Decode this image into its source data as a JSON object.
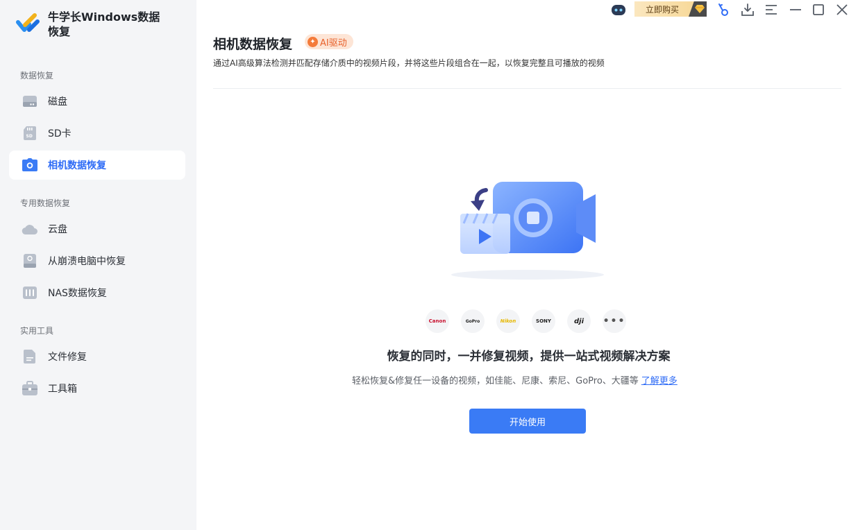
{
  "app": {
    "title": "牛学长Windows数据恢复"
  },
  "sidebar": {
    "sections": [
      {
        "label": "数据恢复"
      },
      {
        "label": "专用数据恢复"
      },
      {
        "label": "实用工具"
      }
    ],
    "items": [
      {
        "label": "磁盘",
        "icon": "disk-icon",
        "active": false
      },
      {
        "label": "SD卡",
        "icon": "sd-card-icon",
        "active": false
      },
      {
        "label": "相机数据恢复",
        "icon": "camera-icon",
        "active": true
      },
      {
        "label": "云盘",
        "icon": "cloud-icon",
        "active": false
      },
      {
        "label": "从崩溃电脑中恢复",
        "icon": "crashed-pc-icon",
        "active": false
      },
      {
        "label": "NAS数据恢复",
        "icon": "nas-icon",
        "active": false
      },
      {
        "label": "文件修复",
        "icon": "file-repair-icon",
        "active": false
      },
      {
        "label": "工具箱",
        "icon": "toolbox-icon",
        "active": false
      }
    ]
  },
  "topbar": {
    "buy_label": "立即购买"
  },
  "main": {
    "title": "相机数据恢复",
    "ai_badge": "AI驱动",
    "description": "通过AI高级算法检测并匹配存储介质中的视频片段，并将这些片段组合在一起，以恢复完整且可播放的视频",
    "brands": [
      "Canon",
      "GoPro",
      "Nikon",
      "SONY",
      "dji",
      "more"
    ],
    "headline": "恢复的同时，一并修复视频，提供一站式视频解决方案",
    "subline": "轻松恢复&修复任一设备的视频，如佳能、尼康、索尼、GoPro、大疆等",
    "learn_more": "了解更多",
    "start_button": "开始使用"
  },
  "colors": {
    "accent": "#2f6cf6",
    "button": "#3a7bf5",
    "ai_badge": "#e8622c"
  }
}
